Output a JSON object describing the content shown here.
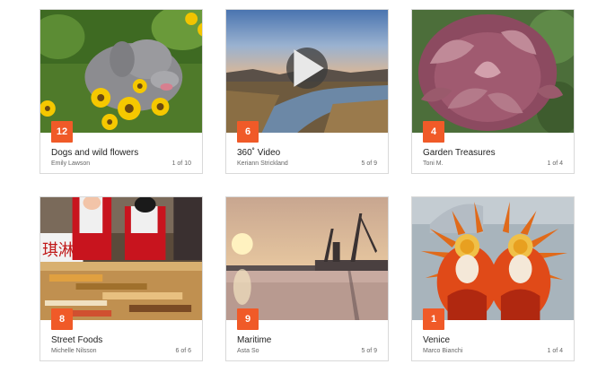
{
  "cards": [
    {
      "count": "12",
      "title": "Dogs and wild flowers",
      "author": "Emily Lawson",
      "position": "1 of 10",
      "image": "dog-flowers"
    },
    {
      "count": "6",
      "title": "360˚ Video",
      "author": "Keriann Strickland",
      "position": "5 of 9",
      "image": "river-dusk",
      "play_icon": "play-icon"
    },
    {
      "count": "4",
      "title": "Garden Treasures",
      "author": "Toni M.",
      "position": "1 of 4",
      "image": "artichoke"
    },
    {
      "count": "8",
      "title": "Street Foods",
      "author": "Michelle Nilsson",
      "position": "6 of 6",
      "image": "street-food-stall"
    },
    {
      "count": "9",
      "title": "Maritime",
      "author": "Asta So",
      "position": "5 of 9",
      "image": "harbor-sunset"
    },
    {
      "count": "1",
      "title": "Venice",
      "author": "Marco Bianchi",
      "position": "1 of 4",
      "image": "venice-masks"
    }
  ],
  "colors": {
    "badge": "#f05a28",
    "border": "#d9d9d9"
  }
}
